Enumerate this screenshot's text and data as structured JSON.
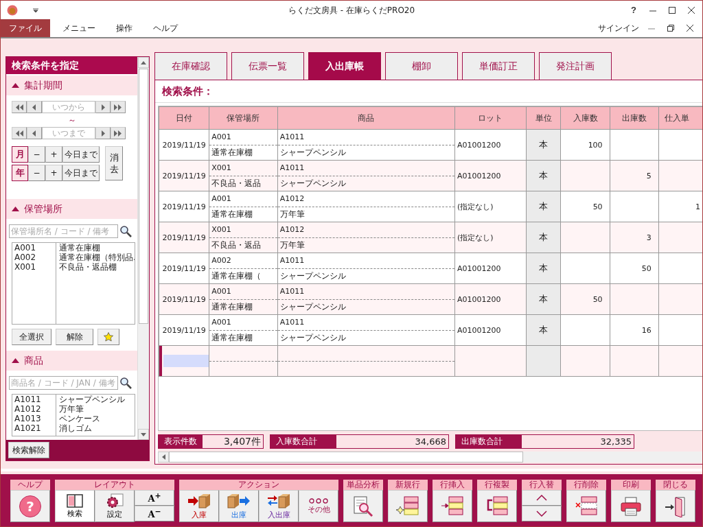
{
  "window": {
    "title": "らくだ文房具 - 在庫らくだPRO20",
    "help": "?",
    "signin": "サインイン"
  },
  "menu": [
    {
      "label": "ファイル",
      "selected": true
    },
    {
      "label": "メニュー",
      "selected": false
    },
    {
      "label": "操作",
      "selected": false
    },
    {
      "label": "ヘルプ",
      "selected": false
    }
  ],
  "sidebar": {
    "title": "検索条件を指定",
    "period": {
      "title": "集計期間",
      "expanded": true,
      "from_placeholder": "いつから",
      "separator": "～",
      "to_placeholder": "いつまで",
      "steps": [
        {
          "unit": "月",
          "minus": "−",
          "plus": "+",
          "today": "今日まで"
        },
        {
          "unit": "年",
          "minus": "−",
          "plus": "+",
          "today": "今日まで"
        }
      ],
      "clear": "消去"
    },
    "locations": {
      "title": "保管場所",
      "expanded": true,
      "placeholder": "保管場所名 / コード / 備考",
      "items": [
        {
          "code": "A001",
          "name": "通常在庫棚"
        },
        {
          "code": "A002",
          "name": "通常在庫棚（特別品."
        },
        {
          "code": "X001",
          "name": "不良品・返品棚"
        }
      ],
      "buttons": [
        "全選択",
        "解除"
      ]
    },
    "products": {
      "title": "商品",
      "expanded": true,
      "placeholder": "商品名 / コード / JAN / 備考",
      "items": [
        {
          "code": "A1011",
          "name": "シャープペンシル"
        },
        {
          "code": "A1012",
          "name": "万年筆"
        },
        {
          "code": "A1013",
          "name": "ペンケース"
        },
        {
          "code": "A1021",
          "name": "消しゴム"
        }
      ]
    },
    "reset": "検索解除"
  },
  "tabs": [
    {
      "label": "在庫確認",
      "selected": false
    },
    {
      "label": "伝票一覧",
      "selected": false
    },
    {
      "label": "入出庫帳",
      "selected": true
    },
    {
      "label": "棚卸",
      "selected": false
    },
    {
      "label": "単価訂正",
      "selected": false
    },
    {
      "label": "発注計画",
      "selected": false
    }
  ],
  "search_conditions": "検索条件：",
  "table": {
    "columns": [
      "日付",
      "保管場所",
      "商品",
      "ロット",
      "単位",
      "入庫数",
      "出庫数",
      "仕入単"
    ],
    "rows": [
      {
        "date": "2019/11/19",
        "location_code": "A001",
        "location_name": "通常在庫棚",
        "product_code": "A1011",
        "product_name": "シャープペンシル",
        "lot": "A01001200",
        "unit": "本",
        "in": "100",
        "selected": false
      },
      {
        "date": "2019/11/19",
        "location_code": "X001",
        "location_name": "不良品・返品",
        "product_code": "A1011",
        "product_name": "シャープペンシル",
        "lot": "A01001200",
        "unit": "本",
        "out": "5",
        "selected": false
      },
      {
        "date": "2019/11/19",
        "location_code": "A001",
        "location_name": "通常在庫棚",
        "product_code": "A1012",
        "product_name": "万年筆",
        "lot": "(指定なし)",
        "unit": "本",
        "in": "50",
        "column_8": "1",
        "selected": false
      },
      {
        "date": "2019/11/19",
        "location_code": "X001",
        "location_name": "不良品・返品",
        "product_code": "A1012",
        "product_name": "万年筆",
        "lot": "(指定なし)",
        "unit": "本",
        "out": "3",
        "selected": false
      },
      {
        "date": "2019/11/19",
        "location_code": "A002",
        "location_name": "通常在庫棚（",
        "product_code": "A1011",
        "product_name": "シャープペンシル",
        "lot": "A01001200",
        "unit": "本",
        "out": "50",
        "selected": false
      },
      {
        "date": "2019/11/19",
        "location_code": "A001",
        "location_name": "通常在庫棚",
        "product_code": "A1011",
        "product_name": "シャープペンシル",
        "lot": "A01001200",
        "unit": "本",
        "in": "50",
        "selected": false
      },
      {
        "date": "2019/11/19",
        "location_code": "A001",
        "location_name": "通常在庫棚",
        "product_code": "A1011",
        "product_name": "シャープペンシル",
        "lot": "A01001200",
        "unit": "本",
        "out": "16",
        "selected": false
      }
    ],
    "new_row": {
      "selected": true
    }
  },
  "summary": [
    {
      "label": "表示件数",
      "value": "3,407件"
    },
    {
      "label": "入庫数合計",
      "value": "34,668"
    },
    {
      "label": "出庫数合計",
      "value": "32,335"
    }
  ],
  "toolbar": [
    {
      "label": "ヘルプ",
      "buttons": [
        {
          "kind": "help",
          "label": "?"
        }
      ]
    },
    {
      "label": "レイアウト",
      "buttons": [
        {
          "kind": "panel",
          "label": "検索",
          "selected": true
        },
        {
          "kind": "gear",
          "label": "設定",
          "selected": false
        },
        {
          "kind": "font",
          "big": "A$^{+}$",
          "small": "A$^{−}$"
        }
      ]
    },
    {
      "label": "アクション",
      "buttons": [
        {
          "kind": "receive",
          "label": "入庫"
        },
        {
          "kind": "ship",
          "label": "出庫"
        },
        {
          "kind": "transfer",
          "label": "入出庫"
        },
        {
          "kind": "more",
          "label": "その他"
        }
      ]
    },
    {
      "label": "単品分析",
      "buttons": [
        {
          "kind": "analyze"
        }
      ]
    },
    {
      "label": "新規行",
      "buttons": [
        {
          "kind": "newrow"
        }
      ]
    },
    {
      "label": "行挿入",
      "buttons": [
        {
          "kind": "insert"
        }
      ]
    },
    {
      "label": "行複製",
      "buttons": [
        {
          "kind": "duplicate"
        }
      ]
    },
    {
      "label": "行入替",
      "buttons": [
        {
          "kind": "swap"
        }
      ]
    },
    {
      "label": "行削除",
      "buttons": [
        {
          "kind": "delete"
        }
      ]
    },
    {
      "label": "印刷",
      "buttons": [
        {
          "kind": "print"
        }
      ]
    },
    {
      "label": "閉じる",
      "buttons": [
        {
          "kind": "exit"
        }
      ]
    }
  ]
}
